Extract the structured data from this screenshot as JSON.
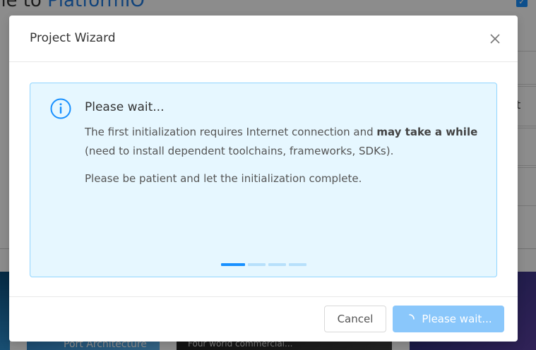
{
  "background": {
    "title_prefix": "ne to ",
    "title_brand": "PlatformIO",
    "panel_text": "t",
    "card2_caption": "Port Architecture",
    "card3_caption": "Four world commercial..."
  },
  "modal": {
    "title": "Project Wizard",
    "close_icon": "close-icon",
    "alert": {
      "icon": "info-circle-icon",
      "title": "Please wait...",
      "line1_prefix": "The first initialization requires Internet connection and ",
      "line1_bold": "may take a while",
      "line1_suffix": " (need to install dependent toolchains, frameworks, SDKs).",
      "line2": "Please be patient and let the initialization complete."
    },
    "footer": {
      "cancel_label": "Cancel",
      "primary_label": "Please wait...",
      "primary_icon": "loading-spinner-icon"
    }
  },
  "colors": {
    "accent": "#1890ff",
    "alert_bg": "#e6f7ff",
    "alert_border": "#91d5ff",
    "primary_disabled": "#8ac7fb"
  }
}
